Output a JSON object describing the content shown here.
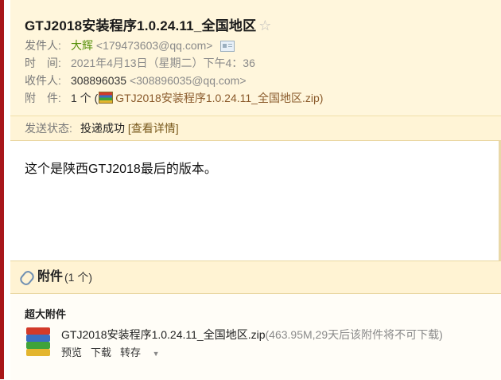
{
  "subject": "GTJ2018安装程序1.0.24.11_全国地区",
  "header": {
    "sender_label": "发件人:",
    "sender_name": "大辉",
    "sender_email": "<179473603@qq.com>",
    "time_label": "时　间:",
    "time_value": "2021年4月13日（星期二）下午4：36",
    "recipient_label": "收件人:",
    "recipient_name": "308896035",
    "recipient_email": "<308896035@qq.com>",
    "attachment_label": "附　件:",
    "attachment_count": "1 个 (",
    "attachment_file": "GTJ2018安装程序1.0.24.11_全国地区.zip",
    "attachment_close": ")"
  },
  "status": {
    "label": "发送状态:",
    "value": "投递成功",
    "details_link": "[查看详情]"
  },
  "body": {
    "text": "这个是陕西GTJ2018最后的版本。"
  },
  "attachments": {
    "title": "附件",
    "count": "(1 个)",
    "super_label": "超大附件",
    "file_name": "GTJ2018安装程序1.0.24.11_全国地区.zip",
    "file_meta": "(463.95M,29天后该附件将不可下载)",
    "actions": [
      "预览",
      "下载",
      "转存"
    ]
  },
  "icons": {
    "star": "star-icon",
    "contact_card": "contact-card-icon",
    "zip": "zip-archive-icon",
    "paperclip": "paperclip-icon",
    "dropdown": "caret-down-icon"
  },
  "colors": {
    "header_bg": "#fff6dc",
    "sender_green": "#55900a",
    "left_accent": "#a8161a"
  }
}
